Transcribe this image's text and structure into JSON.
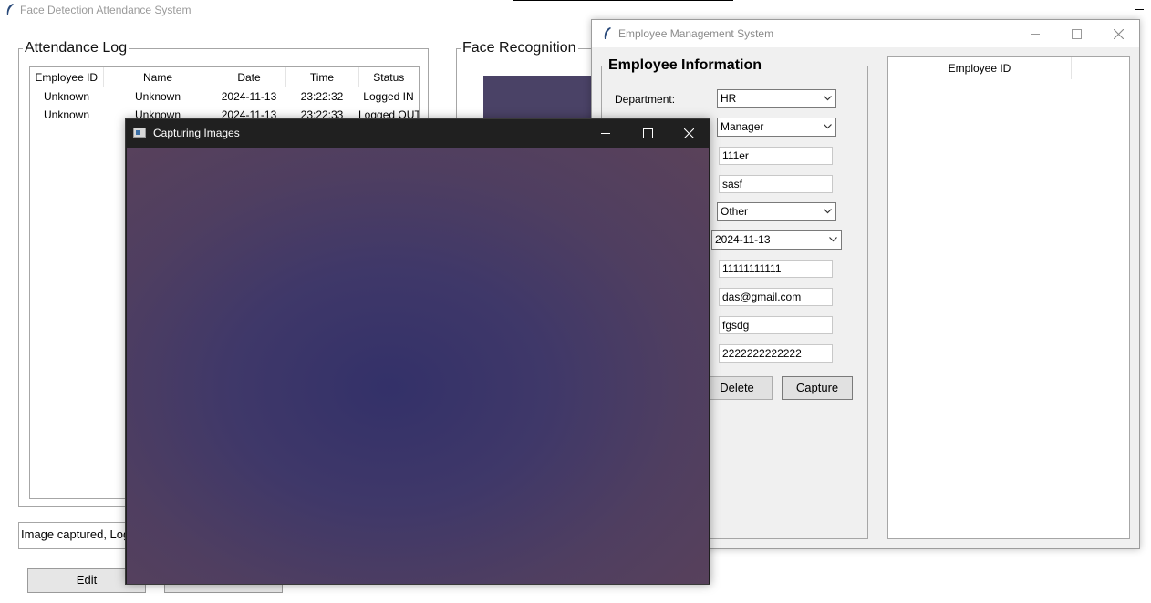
{
  "main_window": {
    "title": "Face Detection Attendance System",
    "attendance_log": {
      "title": "Attendance Log",
      "columns": [
        "Employee ID",
        "Name",
        "Date",
        "Time",
        "Status"
      ],
      "rows": [
        [
          "Unknown",
          "Unknown",
          "2024-11-13",
          "23:22:32",
          "Logged IN"
        ],
        [
          "Unknown",
          "Unknown",
          "2024-11-13",
          "23:22:33",
          "Logged OUT"
        ]
      ]
    },
    "face_recognition_title": "Face Recognition",
    "status_text": "Image captured, Logged OUT",
    "edit_button": "Edit"
  },
  "employee_window": {
    "title": "Employee Management System",
    "info_title": "Employee Information",
    "department_label": "Department:",
    "fields": {
      "department": "HR",
      "position": "Manager",
      "entry_1": "111er",
      "entry_2": "sasf",
      "gender": "Other",
      "date": "2024-11-13",
      "phone": "11111111111",
      "email": "das@gmail.com",
      "entry_3": "fgsdg",
      "entry_4": "2222222222222"
    },
    "buttons": {
      "delete": "Delete",
      "capture": "Capture"
    },
    "table_header": "Employee ID"
  },
  "capture_window": {
    "title": "Capturing Images"
  },
  "colors": {
    "feed_dark": "#32306a",
    "feed_edge": "#5c4258",
    "titlebar_dark": "#202020"
  }
}
